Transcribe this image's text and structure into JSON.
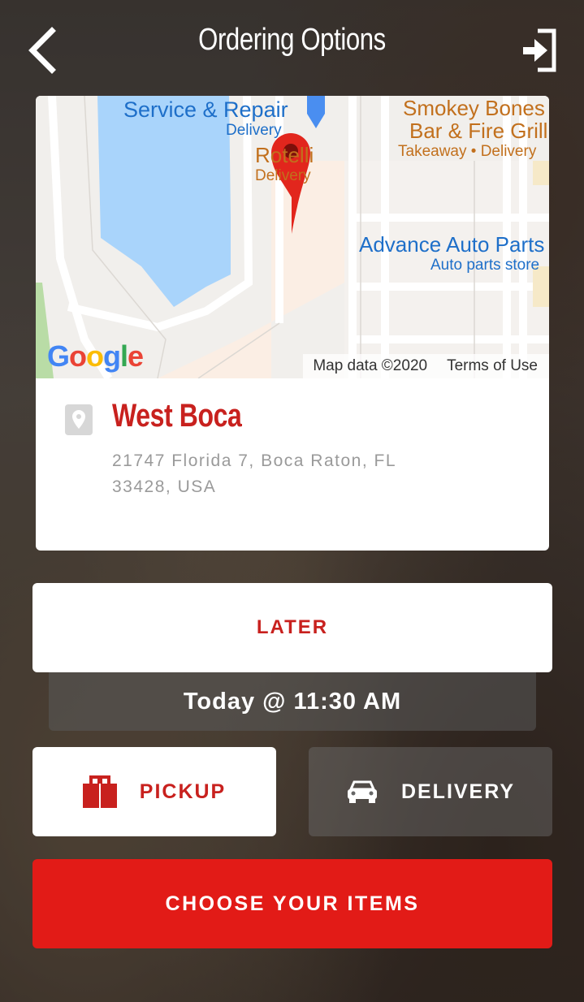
{
  "header": {
    "title": "Ordering Options",
    "back_icon": "chevron-left-icon",
    "login_icon": "sign-in-icon"
  },
  "map": {
    "labels": {
      "service_repair": "Service & Repair",
      "service_repair_sub": "Delivery",
      "rotelli": "Rotelli",
      "rotelli_sub": "Delivery",
      "smokey_bones_1": "Smokey Bones",
      "smokey_bones_2": "Bar & Fire Grill",
      "smokey_bones_sub": "Takeaway • Delivery",
      "advance_auto": "Advance Auto Parts",
      "advance_auto_sub": "Auto parts store"
    },
    "google_logo": "Google",
    "map_data": "Map data ©2020",
    "terms": "Terms of Use"
  },
  "location": {
    "name": "West Boca",
    "address": "21747 Florida 7, Boca Raton, FL 33428, USA",
    "icon": "map-pin-icon"
  },
  "schedule": {
    "later_label": "LATER",
    "time_label": "Today @ 11:30 AM"
  },
  "modes": {
    "pickup_label": "PICKUP",
    "pickup_icon": "shopping-bag-icon",
    "delivery_label": "DELIVERY",
    "delivery_icon": "car-icon"
  },
  "cta": {
    "choose_label": "CHOOSE YOUR ITEMS"
  },
  "colors": {
    "brand_red": "#c8211e",
    "cta_red": "#e21b17"
  }
}
